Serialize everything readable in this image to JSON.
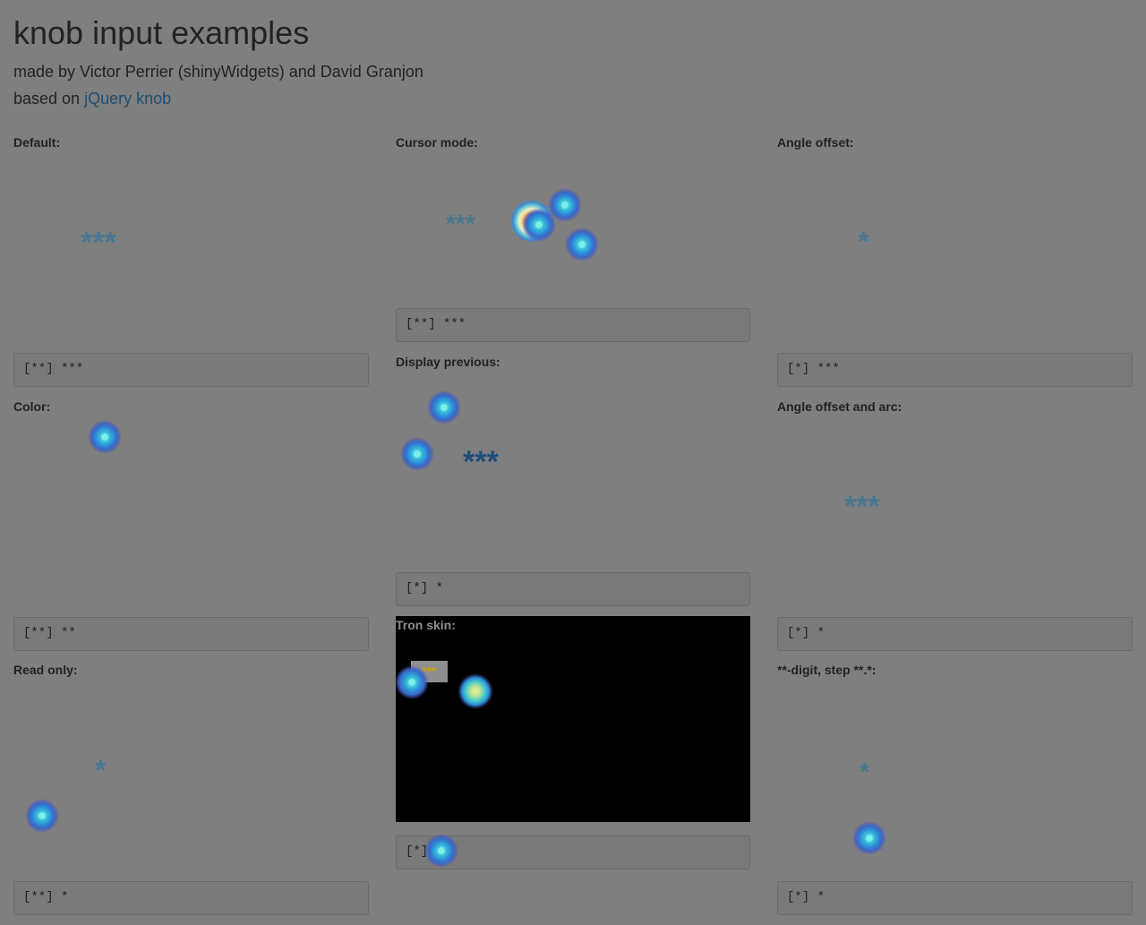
{
  "page": {
    "title": "knob input examples",
    "credit": "made by Victor Perrier (shinyWidgets) and David Granjon",
    "based_on_prefix": "based on ",
    "based_on_link": "jQuery knob"
  },
  "knobs": {
    "default": {
      "label": "Default:",
      "value": "***",
      "output": "[**] ***"
    },
    "cursor": {
      "label": "Cursor mode:",
      "value": "***",
      "output": "[**] ***"
    },
    "angle_offset": {
      "label": "Angle offset:",
      "value": "*",
      "output": "[*] ***"
    },
    "color": {
      "label": "Color:",
      "output": "[**] **"
    },
    "display_previous": {
      "label": "Display previous:",
      "value": "***",
      "output": "[*] *"
    },
    "angle_offset_arc": {
      "label": "Angle offset and arc:",
      "value": "***",
      "output": "[*] *"
    },
    "read_only": {
      "label": "Read only:",
      "value": "*",
      "output": "[**] *"
    },
    "tron": {
      "label": "Tron skin:",
      "value": "***",
      "output": "[*] *"
    },
    "digit_step": {
      "label": "**-digit, step **.*:",
      "value": "*",
      "output": "[*] *"
    }
  },
  "colors": {
    "background": "#7f7f7f",
    "knob_text": "#4a7790",
    "link": "#1d4f73",
    "tron_panel": "#000000"
  }
}
